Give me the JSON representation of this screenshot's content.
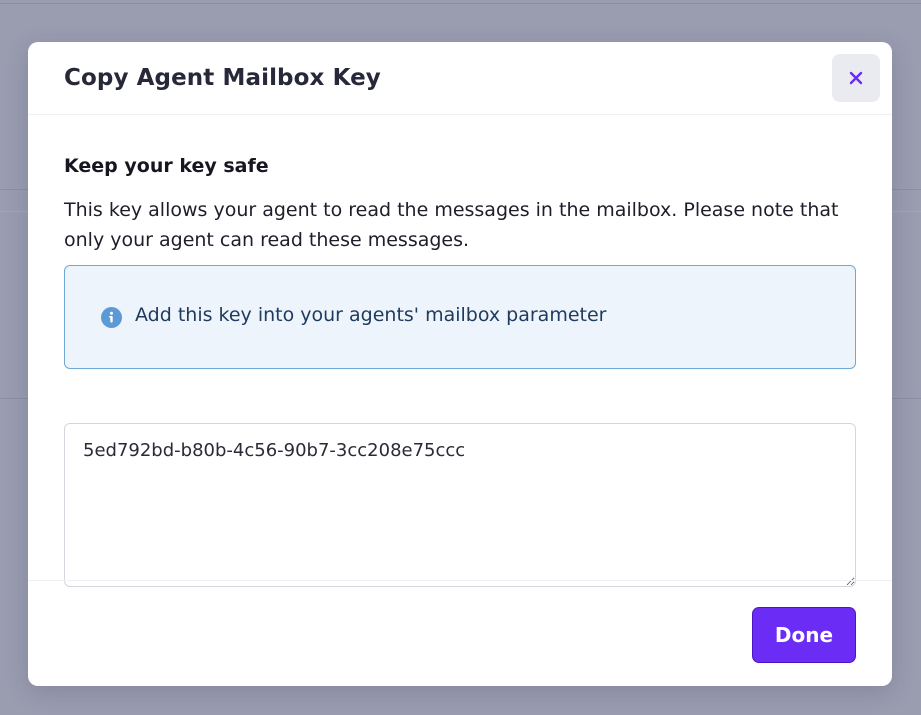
{
  "dialog": {
    "title": "Copy Agent Mailbox Key",
    "close_icon": "close-icon",
    "section_heading": "Keep your key safe",
    "description": "This key allows your agent to read the messages in the mailbox. Please note that only your agent can read these messages.",
    "info": {
      "icon": "info-icon",
      "text": "Add this key into your agents' mailbox parameter"
    },
    "key_value": "5ed792bd-b80b-4c56-90b7-3cc208e75ccc",
    "done_label": "Done"
  },
  "colors": {
    "accent": "#6b2cf5",
    "overlay": "#9a9cb0",
    "info_background": "#edf4fc",
    "info_border": "#6fa8d4",
    "info_icon": "#5c9ad6",
    "close_icon": "#6b2cf5"
  }
}
